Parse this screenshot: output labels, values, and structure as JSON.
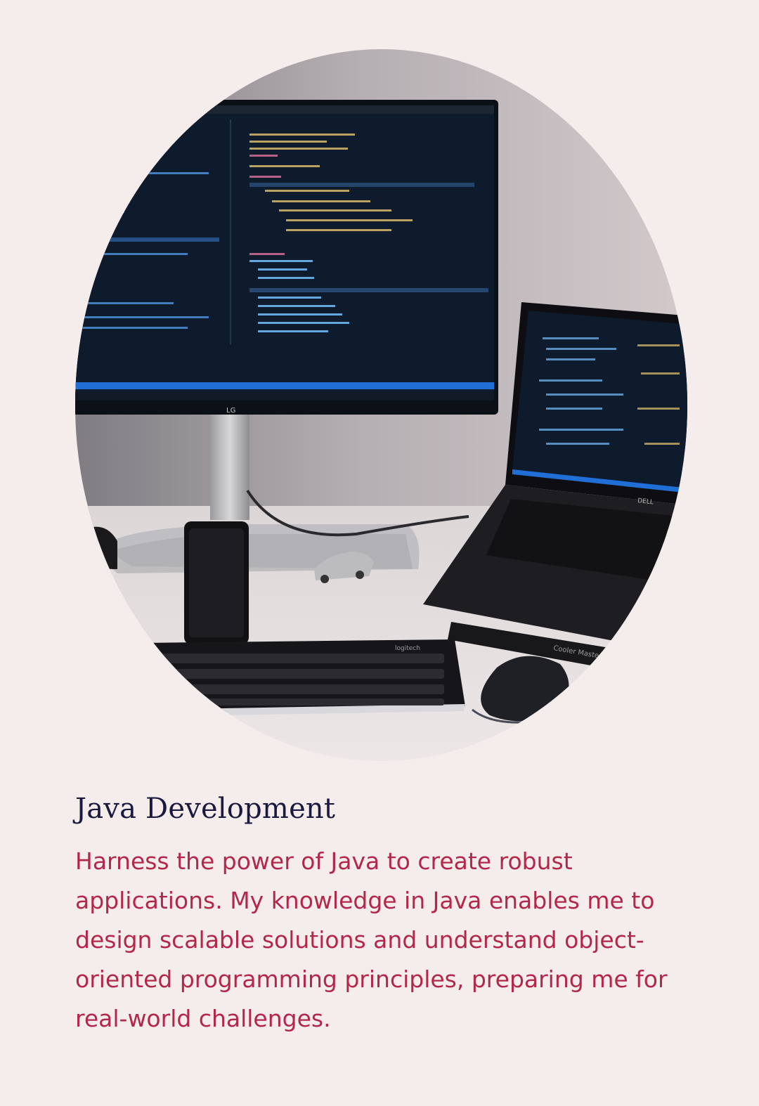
{
  "service": {
    "title": "Java Development",
    "description": "Harness the power of Java to create robust applications. My knowledge in Java enables me to design scalable solutions and understand object-oriented programming principles, preparing me for real-world challenges.",
    "image": {
      "monitor_brand": "LG",
      "laptop_brand": "DELL",
      "keyboard_brand": "logitech",
      "stand_brand": "Cooler Master"
    }
  },
  "colors": {
    "background": "#f5ecec",
    "title": "#1a1a3e",
    "description": "#b3284a"
  }
}
